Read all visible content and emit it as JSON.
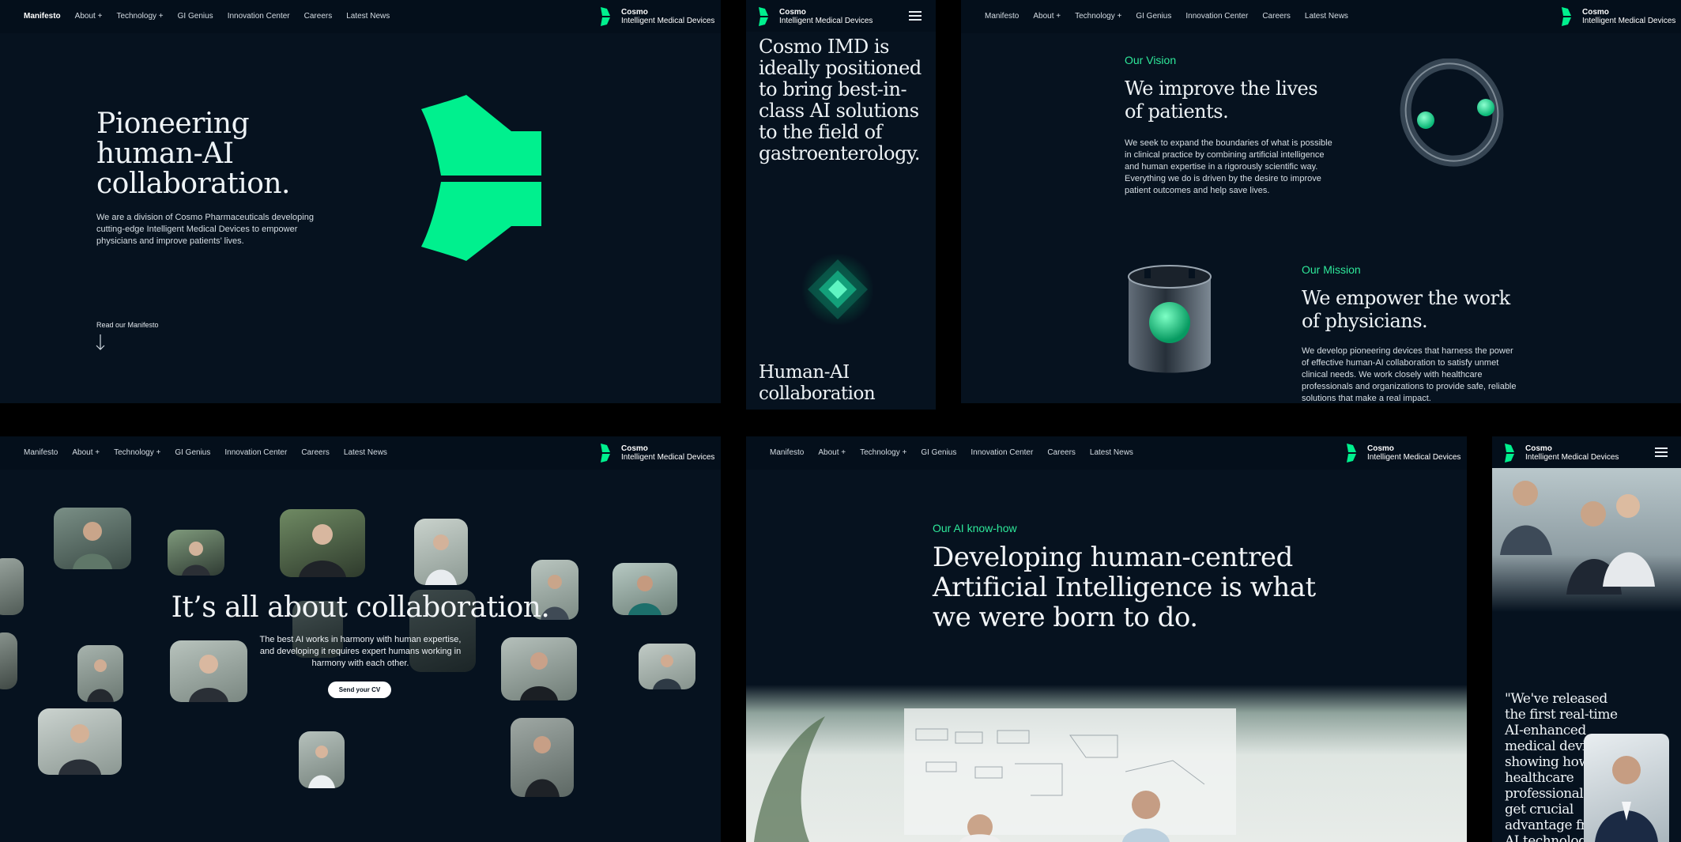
{
  "colors": {
    "accent": "#00f08e",
    "background": "#06121f",
    "nav": "#040f1b",
    "text": "#e8eef3"
  },
  "nav": {
    "items": [
      "Manifesto",
      "About +",
      "Technology +",
      "GI Genius",
      "Innovation Center",
      "Careers",
      "Latest News"
    ]
  },
  "logo": {
    "line1": "Cosmo",
    "line2": "Intelligent Medical Devices"
  },
  "hero": {
    "title_lines": [
      "Pioneering",
      "human-AI",
      "collaboration."
    ],
    "description": "We are a division of Cosmo Pharmaceuticals developing cutting-edge Intelligent Medical Devices to empower physicians and improve patients’ lives.",
    "cta": "Read our Manifesto",
    "arrow_icon": "arrow-down-icon"
  },
  "mobile_positioning": {
    "statement": "Cosmo IMD is ideally positioned to bring best-in-class AI solutions to the field of gastroenterology.",
    "caption_lines": [
      "Human-AI",
      "collaboration"
    ]
  },
  "vision": {
    "eyebrow": "Our Vision",
    "title_lines": [
      "We improve the lives",
      "of patients."
    ],
    "body": "We seek to expand the boundaries of what is possible in clinical practice by combining artificial intelligence and human expertise in a rigorously scientific way. Everything we do is driven by the desire to improve patient outcomes and help save lives."
  },
  "mission": {
    "eyebrow": "Our Mission",
    "title_lines": [
      "We empower the work",
      "of physicians."
    ],
    "body": "We develop pioneering devices that harness the power of effective human-AI collaboration to satisfy unmet clinical needs. We work closely with healthcare professionals and organizations to provide safe, reliable solutions that make a real impact."
  },
  "careers": {
    "title": "It’s all about collaboration.",
    "body_lines": [
      "The best AI works in harmony with human expertise,",
      "and developing it requires expert humans working in",
      "harmony with each other."
    ],
    "cta": "Send your CV"
  },
  "know_how": {
    "eyebrow": "Our AI know-how",
    "title_lines": [
      "Developing human-centred",
      "Artificial Intelligence is what",
      "we were born to do."
    ]
  },
  "mobile_quote": {
    "quote_lines": [
      "\"We've released",
      "the first real-time",
      "AI-enhanced",
      "medical devices,",
      "showing how",
      "healthcare",
      "professionals can",
      "get crucial",
      "advantage from",
      "AI technology"
    ]
  }
}
